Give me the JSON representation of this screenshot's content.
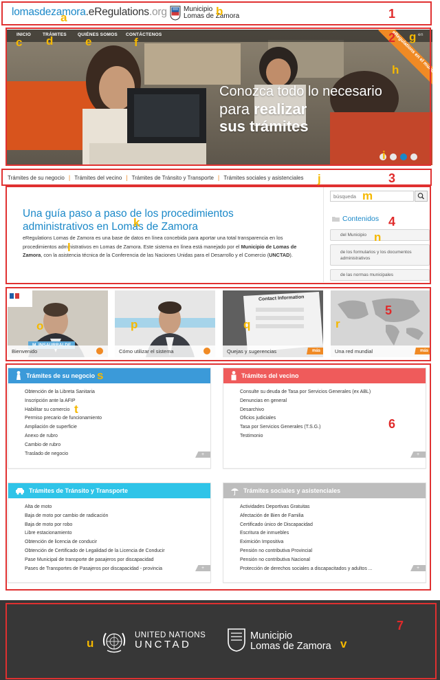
{
  "header": {
    "logo_part1": "lomasdezamora",
    "logo_part2": ".eRegulations",
    "logo_part3": ".org",
    "municipality_line1": "Municipio",
    "municipality_line2": "Lomas de Zamora"
  },
  "nav": {
    "items": [
      "INICIO",
      "TRÁMITES",
      "QUIÉNES SOMOS",
      "CONTÁCTENOS"
    ],
    "language": "en"
  },
  "hero": {
    "line1": "Conozca todo lo necesario",
    "line2_a": "para ",
    "line2_b": "realizar",
    "line3": "sus trámites",
    "ribbon": "eRegulations en el mundo",
    "slides_total": 4,
    "active_slide": 3
  },
  "tabs": [
    "Trámites de su negocio",
    "Trámites del vecino",
    "Trámites de Tránsito y Transporte",
    "Trámites sociales y asistenciales"
  ],
  "guide": {
    "title": "Una guía paso a paso de los procedimientos administrativos en Lomas de Zamora",
    "body_a": "eRegulations Lomas de Zamora es una base de datos en línea concebida para aportar una total transparencia en los procedimientos administrativos en Lomas de Zamora. Este sistema en línea está manejado por el ",
    "body_b": "Municipio de Lomas de Zamora",
    "body_c": ", con la asistencia técnica de la Conferencia de las Naciones Unidas para el Desarrollo y el Comercio (",
    "body_d": "UNCTAD",
    "body_e": ")."
  },
  "search": {
    "placeholder": "búsqueda"
  },
  "contents": {
    "title": "Contenidos",
    "items": [
      "del Municipio",
      "de los formularios y los documentos administrativos",
      "de las normas municipales"
    ]
  },
  "videos": [
    {
      "label": "Bienvenido",
      "overlay": "M. INSAURRALDE"
    },
    {
      "label": "Cómo utilizar el sistema"
    },
    {
      "label": "Quejas y sugerencias",
      "more": "más",
      "form_title": "Contact Information"
    },
    {
      "label": "Una red mundial",
      "more": "más"
    }
  ],
  "panels": [
    {
      "title": "Trámites de su negocio",
      "color": "#3b9ad9",
      "items": [
        "Obtención de la Libreta Sanitaria",
        "Inscripción ante la AFIP",
        "Habilitar su comercio",
        "Permiso precario de funcionamiento",
        "Ampliación de superficie",
        "Anexo de rubro",
        "Cambio de rubro",
        "Traslado de negocio"
      ],
      "more": "+"
    },
    {
      "title": "Trámites del vecino",
      "color": "#ef5b5b",
      "items": [
        "Consulte su deuda de Tasa por Servicios Generales (ex ABL)",
        "Denuncias en general",
        "Desarchivo",
        "Oficios judiciales",
        "Tasa por Servicios Generales (T.S.G.)",
        "Testimonio"
      ],
      "more": "+"
    },
    {
      "title": "Trámites de Tránsito y Transporte",
      "color": "#2fc4e8",
      "items": [
        "Alta de moto",
        "Baja de moto por cambio de radicación",
        "Baja de moto por robo",
        "Libre estacionamiento",
        "Obtención de licencia de conducir",
        "Obtención de Certificado de Legalidad de la Licencia de Conducir",
        "Pase Municipal de transporte de pasajeros por discapacidad",
        "Pases de Transportes de Pasajeros por discapacidad - provincia"
      ],
      "more": "+"
    },
    {
      "title": "Trámites sociales y asistenciales",
      "color": "#bdbdbd",
      "items": [
        "Actividades Deportivas Gratuitas",
        "Afectación de Bien de Familia",
        "Certificado único de Discapacidad",
        "Escritura de inmuebles",
        "Eximición Impositiva",
        "Pensión no contributiva Provincial",
        "Pensión no contributiva Nacional",
        "Protección de derechos sociales a discapacitados y adultos ..."
      ],
      "more": "+"
    }
  ],
  "footer": {
    "un_line1": "UNITED NATIONS",
    "un_line2": "UNCTAD",
    "muni_line1": "Municipio",
    "muni_line2": "Lomas de Zamora"
  },
  "annotations": {
    "sections": [
      "1",
      "2",
      "3",
      "4",
      "5",
      "6",
      "7"
    ],
    "letters": [
      "a",
      "b",
      "c",
      "d",
      "e",
      "f",
      "g",
      "h",
      "i",
      "j",
      "k",
      "l",
      "m",
      "n",
      "o",
      "p",
      "q",
      "r",
      "s",
      "t",
      "u",
      "v"
    ]
  },
  "colors": {
    "accent_blue": "#1a88c8",
    "accent_orange": "#f08a24",
    "annotation_red": "#e03030",
    "annotation_yellow": "#f5b800",
    "footer_bg": "#373737"
  }
}
